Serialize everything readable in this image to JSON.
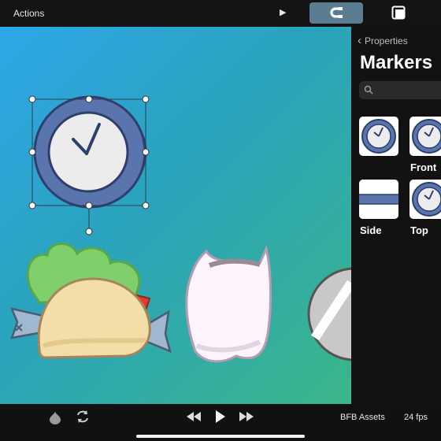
{
  "topbar": {
    "actions_label": "Actions",
    "play_glyph": "▶",
    "magnet_icon": "magnet-icon",
    "layer_icon": "layer-icon"
  },
  "panel": {
    "back_label": "Properties",
    "title": "Markers",
    "search_placeholder": "",
    "thumbs": [
      {
        "label": "",
        "icon": "clock-thumb"
      },
      {
        "label": "Front",
        "icon": "clock-thumb"
      },
      {
        "label": "Side",
        "icon": "side-thumb"
      },
      {
        "label": "Top",
        "icon": "clock-thumb"
      }
    ]
  },
  "bottombar": {
    "assets_label": "BFB Assets",
    "fps_label": "24 fps"
  },
  "colors": {
    "accent": "#5a7d91",
    "clock_blue": "#5a74ad",
    "canvas_top": "#2ea6e8",
    "canvas_bottom": "#3bb68a"
  }
}
